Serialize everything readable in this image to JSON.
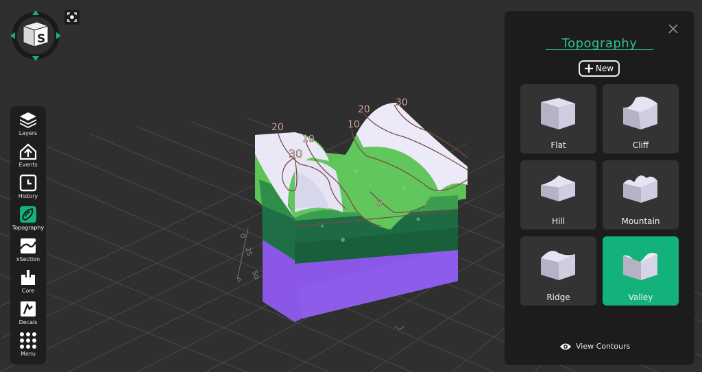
{
  "viewcube": {
    "face_letter": "S"
  },
  "toolbar": {
    "items": [
      {
        "label": "Layers"
      },
      {
        "label": "Events"
      },
      {
        "label": "History"
      },
      {
        "label": "Topography"
      },
      {
        "label": "xSection"
      },
      {
        "label": "Core"
      },
      {
        "label": "Decals"
      },
      {
        "label": "Menu"
      }
    ]
  },
  "model": {
    "contour_labels": [
      "20",
      "10",
      "30",
      "20",
      "10",
      "30",
      "0"
    ],
    "ruler_ticks": [
      "0",
      "25",
      "50"
    ]
  },
  "panel": {
    "title": "Topography",
    "new_label": "New",
    "tiles": [
      {
        "label": "Flat",
        "selected": false
      },
      {
        "label": "Cliff",
        "selected": false
      },
      {
        "label": "Hill",
        "selected": false
      },
      {
        "label": "Mountain",
        "selected": false
      },
      {
        "label": "Ridge",
        "selected": false
      },
      {
        "label": "Valley",
        "selected": true
      }
    ],
    "view_contours_label": "View Contours"
  },
  "colors": {
    "accent": "#13b27b",
    "panel_bg": "#1c1c1c",
    "grass": "#5fc45a",
    "snow": "#e6e4f4",
    "purple": "#8a5ae6",
    "dark_green": "#1f7a4a"
  }
}
